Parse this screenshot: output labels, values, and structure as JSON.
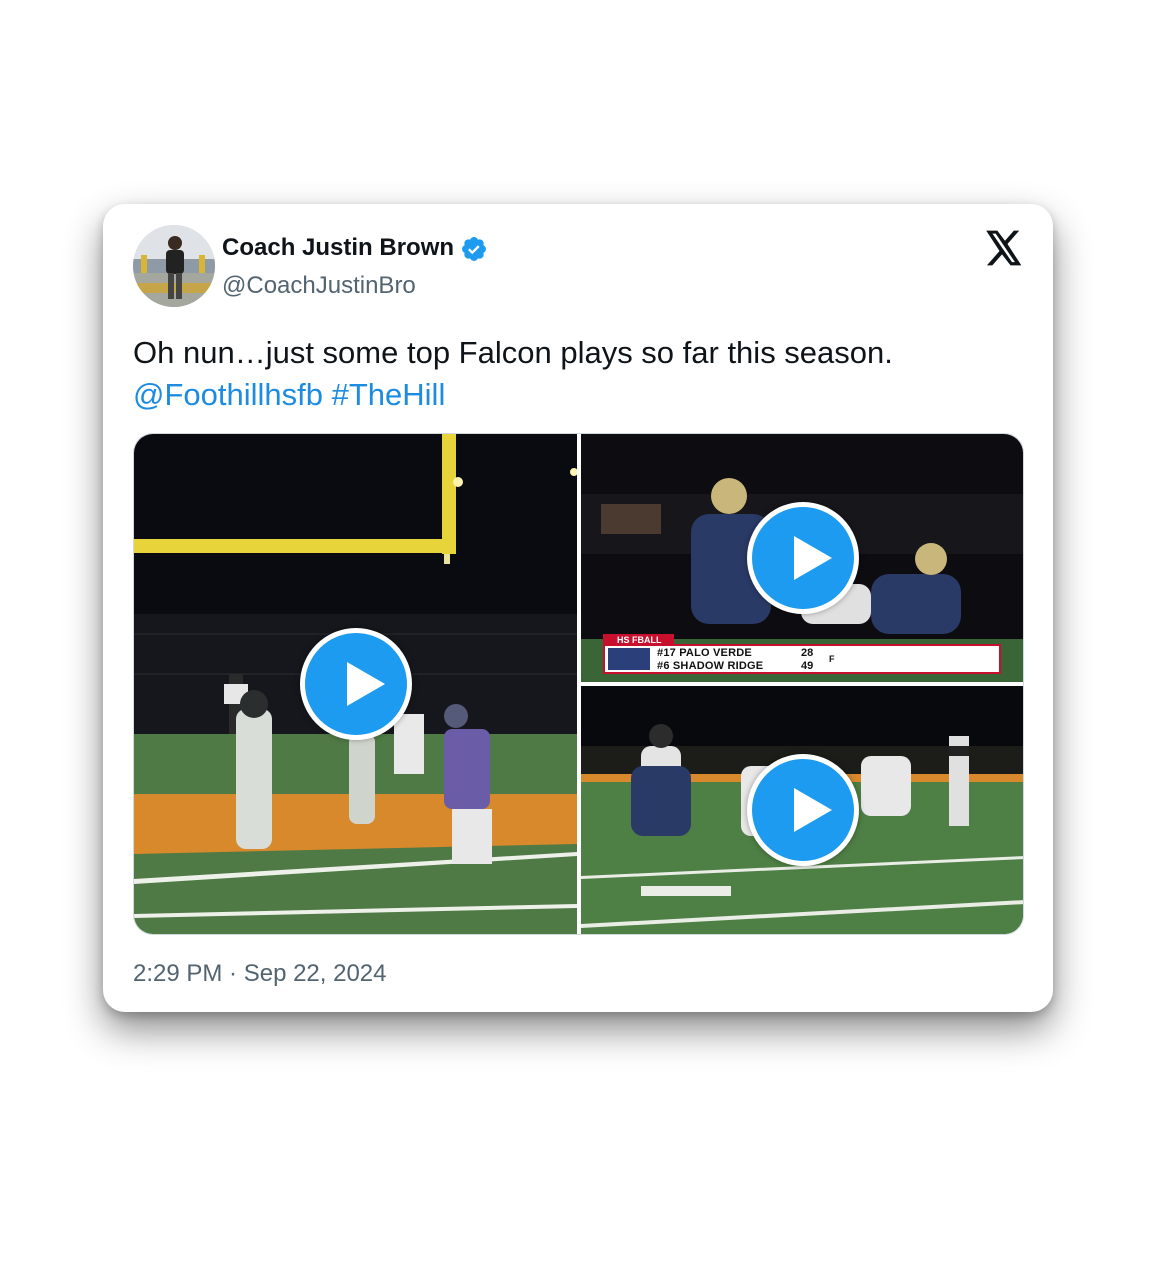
{
  "author": {
    "display_name": "Coach Justin Brown",
    "handle": "@CoachJustinBro",
    "verified": true,
    "avatar_icon": "avatar-photo"
  },
  "platform_icon": "x-logo-icon",
  "tweet": {
    "text": "Oh nun…just some top Falcon plays so far this season.",
    "mention": "@Foothillhsfb",
    "hashtag": "#TheHill"
  },
  "media": {
    "items": [
      {
        "kind": "video",
        "play_icon": "play-icon"
      },
      {
        "kind": "video",
        "play_icon": "play-icon",
        "scorebug": {
          "tag": "HS FBALL",
          "team1": "#17 PALO VERDE",
          "score1": "28",
          "team2": "#6 SHADOW RIDGE",
          "score2": "49",
          "status": "F"
        }
      },
      {
        "kind": "video",
        "play_icon": "play-icon"
      }
    ]
  },
  "timestamp": "2:29 PM · Sep 22, 2024",
  "colors": {
    "link": "#1d8ce0",
    "verified_badge": "#1d9bf0",
    "play_button": "#1d9bf0",
    "secondary_text": "#536471"
  }
}
